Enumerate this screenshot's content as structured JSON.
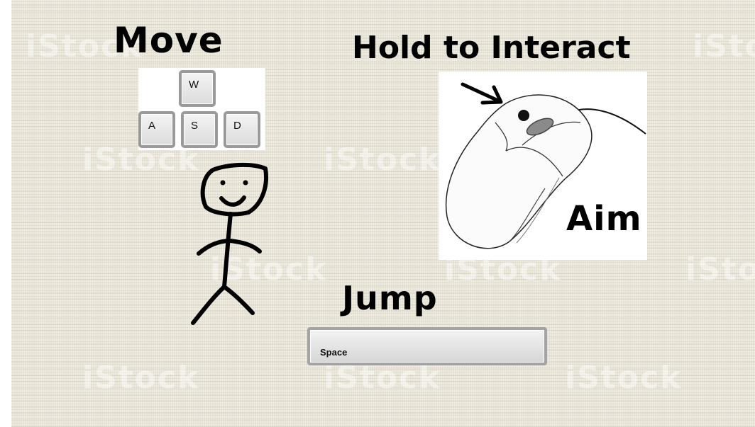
{
  "labels": {
    "move": "Move",
    "interact": "Hold to Interact",
    "aim": "Aim",
    "jump": "Jump"
  },
  "keys": {
    "w": "W",
    "a": "A",
    "s": "S",
    "d": "D",
    "space": "Space"
  },
  "watermark": "iStock",
  "colors": {
    "background": "#e9e6d9",
    "ink": "#000000",
    "key_border": "#9a9a9a"
  }
}
